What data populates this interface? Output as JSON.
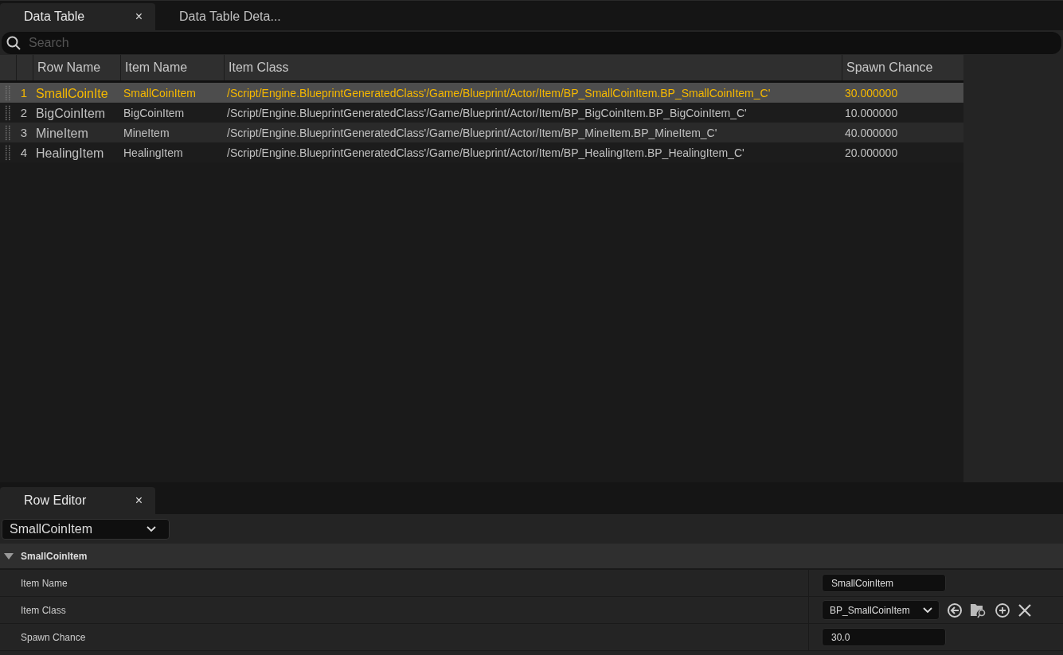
{
  "tabs": [
    {
      "label": "Data Table",
      "close": "×",
      "selected": true
    },
    {
      "label": "Data Table Deta...",
      "selected": false
    }
  ],
  "search": {
    "placeholder": "Search"
  },
  "table": {
    "columns": [
      "Row Name",
      "Item Name",
      "Item Class",
      "Spawn Chance"
    ],
    "rows": [
      {
        "index": "1",
        "row_name": "SmallCoinIte",
        "item_name": "SmallCoinItem",
        "item_class": "/Script/Engine.BlueprintGeneratedClass'/Game/Blueprint/Actor/Item/BP_SmallCoinItem.BP_SmallCoinItem_C'",
        "spawn_chance": "30.000000",
        "selected": true
      },
      {
        "index": "2",
        "row_name": "BigCoinItem",
        "item_name": "BigCoinItem",
        "item_class": "/Script/Engine.BlueprintGeneratedClass'/Game/Blueprint/Actor/Item/BP_BigCoinItem.BP_BigCoinItem_C'",
        "spawn_chance": "10.000000",
        "selected": false
      },
      {
        "index": "3",
        "row_name": "MineItem",
        "item_name": "MineItem",
        "item_class": "/Script/Engine.BlueprintGeneratedClass'/Game/Blueprint/Actor/Item/BP_MineItem.BP_MineItem_C'",
        "spawn_chance": "40.000000",
        "selected": false
      },
      {
        "index": "4",
        "row_name": "HealingItem",
        "item_name": "HealingItem",
        "item_class": "/Script/Engine.BlueprintGeneratedClass'/Game/Blueprint/Actor/Item/BP_HealingItem.BP_HealingItem_C'",
        "spawn_chance": "20.000000",
        "selected": false
      }
    ]
  },
  "row_editor": {
    "tab": {
      "label": "Row Editor",
      "close": "×"
    },
    "row_select": "SmallCoinItem",
    "category": {
      "label": "SmallCoinItem",
      "expanded": true
    },
    "properties": [
      {
        "label": "Item Name",
        "kind": "text",
        "value": "SmallCoinItem"
      },
      {
        "label": "Item Class",
        "kind": "class",
        "value": "BP_SmallCoinItem"
      },
      {
        "label": "Spawn Chance",
        "kind": "text",
        "value": "30.0"
      }
    ]
  }
}
